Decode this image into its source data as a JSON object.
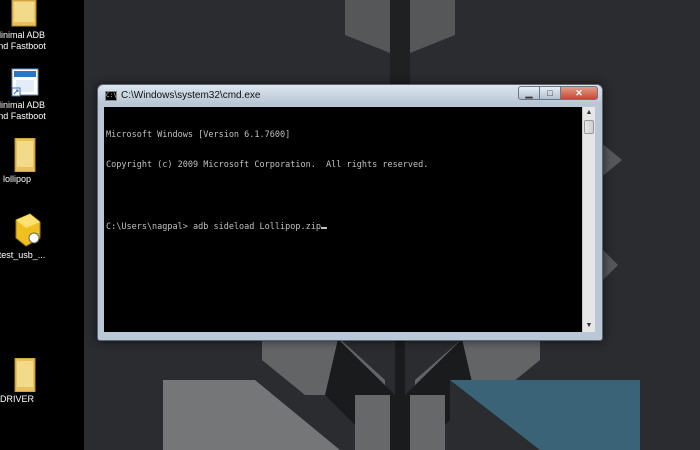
{
  "desktop": {
    "icons": [
      {
        "label_line1": "linimal ADB",
        "label_line2": "nd Fastboot",
        "icon": "folder-icon"
      },
      {
        "label_line1": "linimal ADB",
        "label_line2": "nd Fastboot",
        "icon": "shortcut-app-icon"
      },
      {
        "label_line1": "lollipop",
        "label_line2": "",
        "icon": "folder-icon"
      },
      {
        "label_line1": "test_usb_...",
        "label_line2": "",
        "icon": "installer-icon"
      },
      {
        "label_line1": "DRIVER",
        "label_line2": "",
        "icon": "folder-icon"
      }
    ]
  },
  "window": {
    "title": "C:\\Windows\\system32\\cmd.exe",
    "app_icon_text": "C:\\",
    "minimize_label": "▁",
    "maximize_label": "□",
    "close_label": "✕"
  },
  "console": {
    "lines": [
      "Microsoft Windows [Version 6.1.7600]",
      "Copyright (c) 2009 Microsoft Corporation.  All rights reserved.",
      "",
      "C:\\Users\\nagpal> adb sideload Lollipop.zip"
    ]
  },
  "colors": {
    "desktop_bg": "#2a2c2f",
    "console_bg": "#000000",
    "console_fg": "#c0c0c0",
    "accent_blue": "#3b6378",
    "close_red": "#c24a32"
  }
}
